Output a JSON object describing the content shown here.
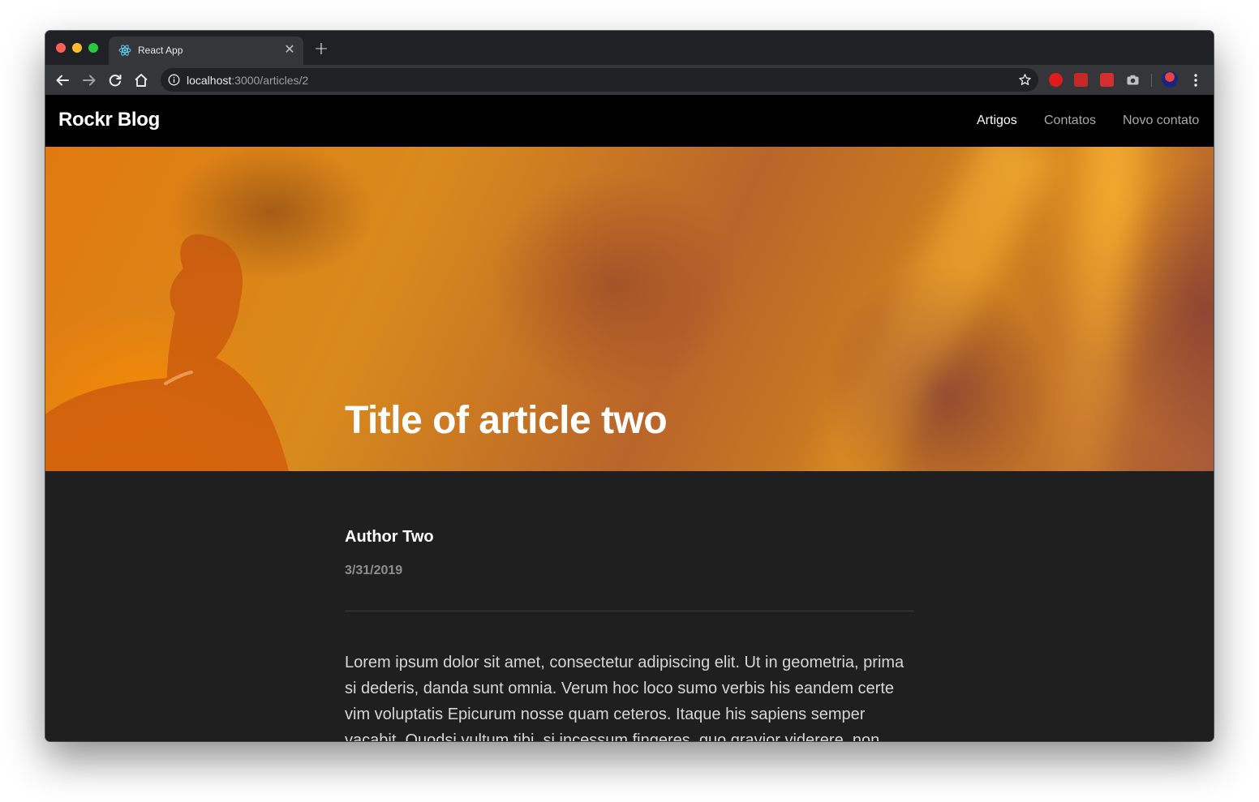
{
  "browser": {
    "tab_title": "React App",
    "url_host": "localhost",
    "url_path": ":3000/articles/2",
    "icons": [
      "react-favicon",
      "close-icon",
      "plus-icon",
      "back-arrow-icon",
      "forward-arrow-icon",
      "reload-icon",
      "home-icon",
      "info-icon",
      "star-icon",
      "kebab-menu-icon"
    ]
  },
  "site": {
    "brand": "Rockr Blog",
    "nav": [
      {
        "label": "Artigos",
        "active": true
      },
      {
        "label": "Contatos",
        "active": false
      },
      {
        "label": "Novo contato",
        "active": false
      }
    ]
  },
  "article": {
    "title": "Title of article two",
    "author": "Author Two",
    "date": "3/31/2019",
    "body": "Lorem ipsum dolor sit amet, consectetur adipiscing elit. Ut in geometria, prima si dederis, danda sunt omnia. Verum hoc loco sumo verbis his eandem certe vim voluptatis Epicurum nosse quam ceteros. Itaque his sapiens semper vacabit. Quodsi vultum tibi, si incessum fingeres, quo gravior viderere, non"
  },
  "colors": {
    "header_bg": "#000000",
    "page_bg": "#1f1f1f",
    "hero_accent": "#e07a10",
    "date_text": "#8e8e8e"
  }
}
